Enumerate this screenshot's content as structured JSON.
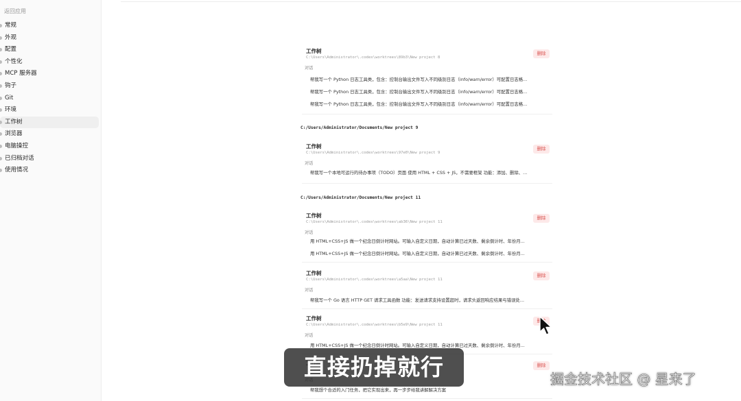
{
  "sidebar": {
    "back_label": "返回应用",
    "items": [
      {
        "label": "常规"
      },
      {
        "label": "外观"
      },
      {
        "label": "配置"
      },
      {
        "label": "个性化"
      },
      {
        "label": "MCP 服务器"
      },
      {
        "label": "钩子"
      },
      {
        "label": "Git"
      },
      {
        "label": "环境"
      },
      {
        "label": "工作树",
        "active": true
      },
      {
        "label": "浏览器"
      },
      {
        "label": "电脑操控"
      },
      {
        "label": "已归档对话"
      },
      {
        "label": "使用情况"
      }
    ]
  },
  "worktree_label": "工作树",
  "conversation_label": "对话",
  "delete_label": "删除",
  "groups": [
    {
      "path": "",
      "cards": [
        {
          "path": "C:\\Users\\Administrator\\.codex\\worktrees\\89b3\\New project 8",
          "conversations": [
            "帮我写一个 Python 日志工具类，包含：控制台输出文件写入不同级别日志（info/warn/error）可配置日志格...",
            "帮我写一个 Python 日志工具类，包含：控制台输出文件写入不同级别日志（info/warn/error）可配置日志格...",
            "帮我写一个 Python 日志工具类，包含：控制台输出文件写入不同级别日志（info/warn/error）可配置日志格..."
          ]
        }
      ]
    },
    {
      "path": "C:/Users/Administrator/Documents/New project 9",
      "cards": [
        {
          "path": "C:\\Users\\Administrator\\.codex\\worktrees\\97e0\\New project 9",
          "conversations": [
            "帮我写一个本地可运行的待办事项（TODO）页面 使用 HTML + CSS + JS，不需要框架 功能：添加、删除、..."
          ]
        }
      ]
    },
    {
      "path": "C:/Users/Administrator/Documents/New project 11",
      "cards": [
        {
          "path": "C:\\Users\\Administrator\\.codex\\worktrees\\ab36\\New project 11",
          "conversations": [
            "用 HTML+CSS+JS 做一个纪念日倒计时网站。可输入自定义日期，自动计算已过天数、剩余倒计时、年份月...",
            "用 HTML+CSS+JS 做一个纪念日倒计时网站。可输入自定义日期，自动计算已过天数、剩余倒计时、年份月..."
          ]
        },
        {
          "path": "C:\\Users\\Administrator\\.codex\\worktrees\\a5aa\\New project 11",
          "conversations": [
            "帮我写一个 Go 语言 HTTP GET 请求工具函数 功能：发送请求支持设置超时，请求头返回响应结果与错误处..."
          ]
        },
        {
          "path": "C:\\Users\\Administrator\\.codex\\worktrees\\b5e9\\New project 11",
          "conversations": [
            "用 HTML+CSS+JS 做一个纪念日倒计时网站。可输入自定义日期，自动计算已过天数、剩余倒计时、年份月..."
          ]
        },
        {
          "path": "",
          "conversations": [
            "帮我想个合适的入门任务，把它实现出来，再一步步给我讲解解决方案"
          ]
        }
      ]
    }
  ],
  "caption": "直接扔掉就行",
  "watermark": "掘金技术社区 @ 星来了"
}
